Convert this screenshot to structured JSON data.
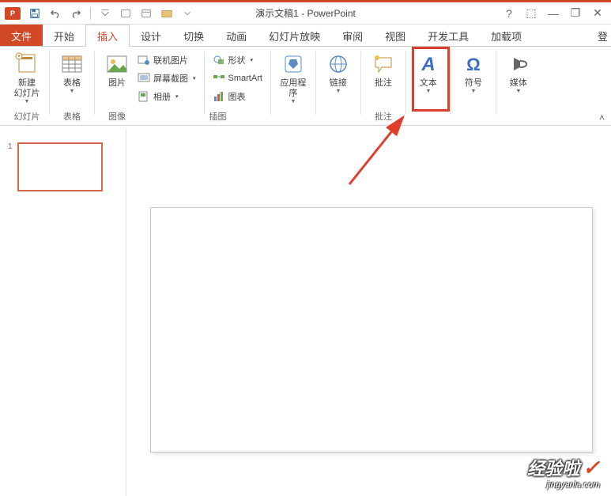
{
  "title": "演示文稿1 - PowerPoint",
  "app_icon_text": "P",
  "tabs": {
    "file": "文件",
    "home": "开始",
    "insert": "插入",
    "design": "设计",
    "transitions": "切换",
    "animations": "动画",
    "slideshow": "幻灯片放映",
    "review": "审阅",
    "view": "视图",
    "developer": "开发工具",
    "addins": "加载项",
    "signin": "登"
  },
  "ribbon": {
    "slides_group": "幻灯片",
    "tables_group": "表格",
    "images_group": "图像",
    "illustrations_group": "插图",
    "comments_group": "批注",
    "new_slide": "新建\n幻灯片",
    "table": "表格",
    "pictures": "图片",
    "online_pictures": "联机图片",
    "screenshot": "屏幕截图",
    "photo_album": "相册",
    "shapes": "形状",
    "smartart": "SmartArt",
    "chart": "图表",
    "apps": "应用程\n序",
    "hyperlink": "链接",
    "comment": "批注",
    "text": "文本",
    "symbols": "符号",
    "media": "媒体"
  },
  "thumb": {
    "num": "1"
  },
  "watermark": {
    "main": "经验啦",
    "sub": "jingyanla.com",
    "check": "✓"
  },
  "win": {
    "help": "?",
    "opts": "⬚",
    "min": "—",
    "restore": "❐",
    "close": "✕"
  }
}
